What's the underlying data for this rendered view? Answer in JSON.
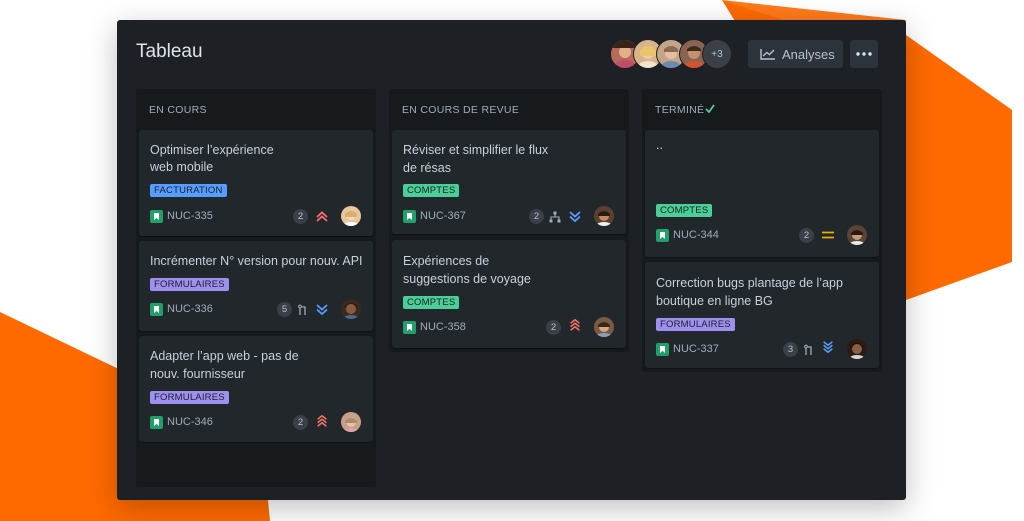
{
  "board": {
    "title": "Tableau",
    "more_avatars": "+3",
    "analyses_label": "Analyses",
    "more_icon": "more-icon"
  },
  "colors": {
    "board_bg": "#1d2125",
    "column_bg": "#161a1d",
    "card_bg": "#22272b",
    "orange": "#ff6a00",
    "tag_comptes": "#4bce97",
    "tag_facturation": "#579dff",
    "tag_formulaires": "#9f8fef",
    "story_green": "#22a06b"
  },
  "columns": [
    {
      "title": "EN COURS",
      "cards": [
        {
          "title_line1": "Optimiser l’expérience",
          "title_line2": "web mobile",
          "tag": "FACTURATION",
          "key": "NUC-335",
          "count": "2",
          "priority": "high"
        },
        {
          "title_line1": "Incrémenter N° version pour nouv. API",
          "title_line2": "",
          "tag": "FORMULAIRES",
          "key": "NUC-336",
          "count": "5",
          "priority": "low"
        },
        {
          "title_line1": "Adapter l’app web - pas de",
          "title_line2": "nouv. fournisseur",
          "tag": "FORMULAIRES",
          "key": "NUC-346",
          "count": "2",
          "priority": "highest"
        }
      ]
    },
    {
      "title": "EN COURS DE REVUE",
      "cards": [
        {
          "title_line1": "Réviser et simplifier le flux",
          "title_line2": "de résas",
          "tag": "COMPTES",
          "key": "NUC-367",
          "count": "2",
          "priority": "low"
        },
        {
          "title_line1": "Expériences de",
          "title_line2": "suggestions de voyage",
          "tag": "COMPTES",
          "key": "NUC-358",
          "count": "2",
          "priority": "highest"
        }
      ]
    },
    {
      "title": "TERMINÉ",
      "cards": [
        {
          "title_line1": "..",
          "title_line2": "",
          "tag": "COMPTES",
          "key": "NUC-344",
          "count": "2",
          "priority": "medium"
        },
        {
          "title_line1": "Correction bugs plantage de l’app",
          "title_line2": "boutique en ligne BG",
          "tag": "FORMULAIRES",
          "key": "NUC-337",
          "count": "3",
          "priority": "lowest"
        }
      ]
    }
  ]
}
